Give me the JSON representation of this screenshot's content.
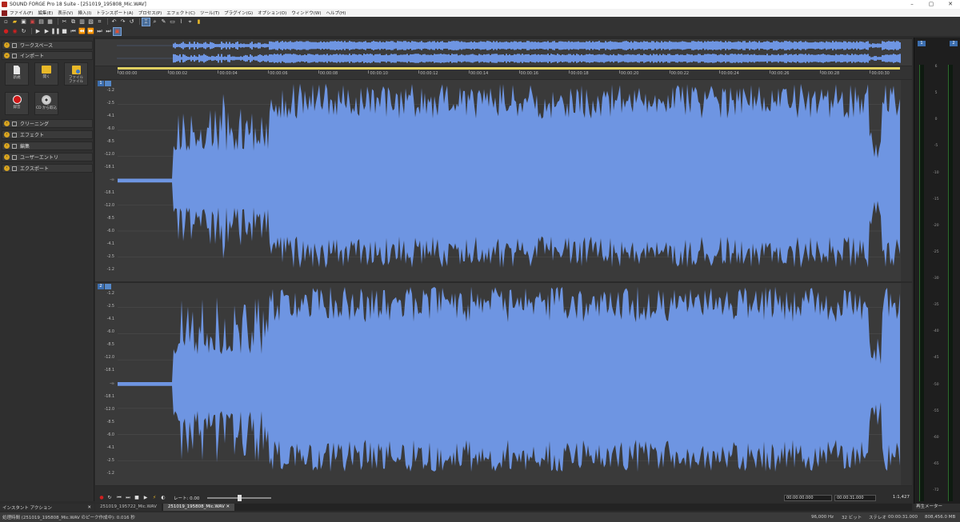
{
  "window": {
    "title": "SOUND FORGE Pro 18 Suite - [251019_195808_Mic.WAV]",
    "controls": [
      "–",
      "▢",
      "✕"
    ]
  },
  "menu": [
    "ファイル(F)",
    "編集(E)",
    "表示(V)",
    "挿入(I)",
    "トランスポート(A)",
    "プロセス(P)",
    "エフェクト(C)",
    "ツール(T)",
    "プラグイン(G)",
    "オプション(O)",
    "ウィンドウ(W)",
    "ヘルプ(H)"
  ],
  "left_panel": {
    "sections": {
      "workspace": "ワークスペース",
      "import": "インポート",
      "cleaning": "クリーニング",
      "effects": "エフェクト",
      "edit": "編集",
      "user_entry": "ユーザーエントリ",
      "export": "エクスポート"
    },
    "tiles": {
      "new": "新規",
      "open": "開く",
      "file_file": "ファイル\nファイル",
      "record": "録音",
      "cd_rip": "CD から取込"
    },
    "bottom_tab": "インスタント アクション"
  },
  "ruler_ticks": [
    "00:00:00",
    "00:00:02",
    "00:00:04",
    "00:00:06",
    "00:00:08",
    "00:00:10",
    "00:00:12",
    "00:00:14",
    "00:00:16",
    "00:00:18",
    "00:00:20",
    "00:00:22",
    "00:00:24",
    "00:00:26",
    "00:00:28",
    "00:00:30"
  ],
  "channels": [
    {
      "num": "1",
      "db_labels": [
        "-1.2",
        "-2.5",
        "-4.1",
        "-6.0",
        "-8.5",
        "-12.0",
        "-18.1",
        "-∞",
        "-18.1",
        "-12.0",
        "-8.5",
        "-6.0",
        "-4.1",
        "-2.5",
        "-1.2"
      ]
    },
    {
      "num": "2",
      "db_labels": [
        "-1.2",
        "-2.5",
        "-4.1",
        "-6.0",
        "-8.5",
        "-12.0",
        "-18.1",
        "-∞",
        "-18.1",
        "-12.0",
        "-8.5",
        "-6.0",
        "-4.1",
        "-2.5",
        "-1.2"
      ]
    }
  ],
  "transport": {
    "rate_label": "レート: 0.00",
    "sel_start": "00:00:00.000",
    "sel_end": "00:00:31.000",
    "zoom": "1:1,427"
  },
  "doc_tabs": [
    "251019_195722_Mic.WAV",
    "251019_195808_Mic.WAV ✕"
  ],
  "meter": {
    "heads": [
      "1",
      "2"
    ],
    "scale": [
      "6",
      "5",
      "0",
      "-5",
      "-10",
      "-15",
      "-20",
      "-25",
      "-30",
      "-35",
      "-40",
      "-45",
      "-50",
      "-55",
      "-60",
      "-65",
      "-72"
    ],
    "tab": "再生メーター"
  },
  "status": {
    "left": "処理時間 (251019_195808_Mic.WAV のピーク作成中): 0.016 秒",
    "rate": "96,000 Hz",
    "bits": "32 ビット",
    "channels": "ステレオ",
    "length": "00:00:31.000",
    "size": "808,456.0 MB"
  },
  "colors": {
    "waveform": "#6e95e2",
    "accent": "#3d6fb0",
    "ruler": "#e0d060"
  }
}
